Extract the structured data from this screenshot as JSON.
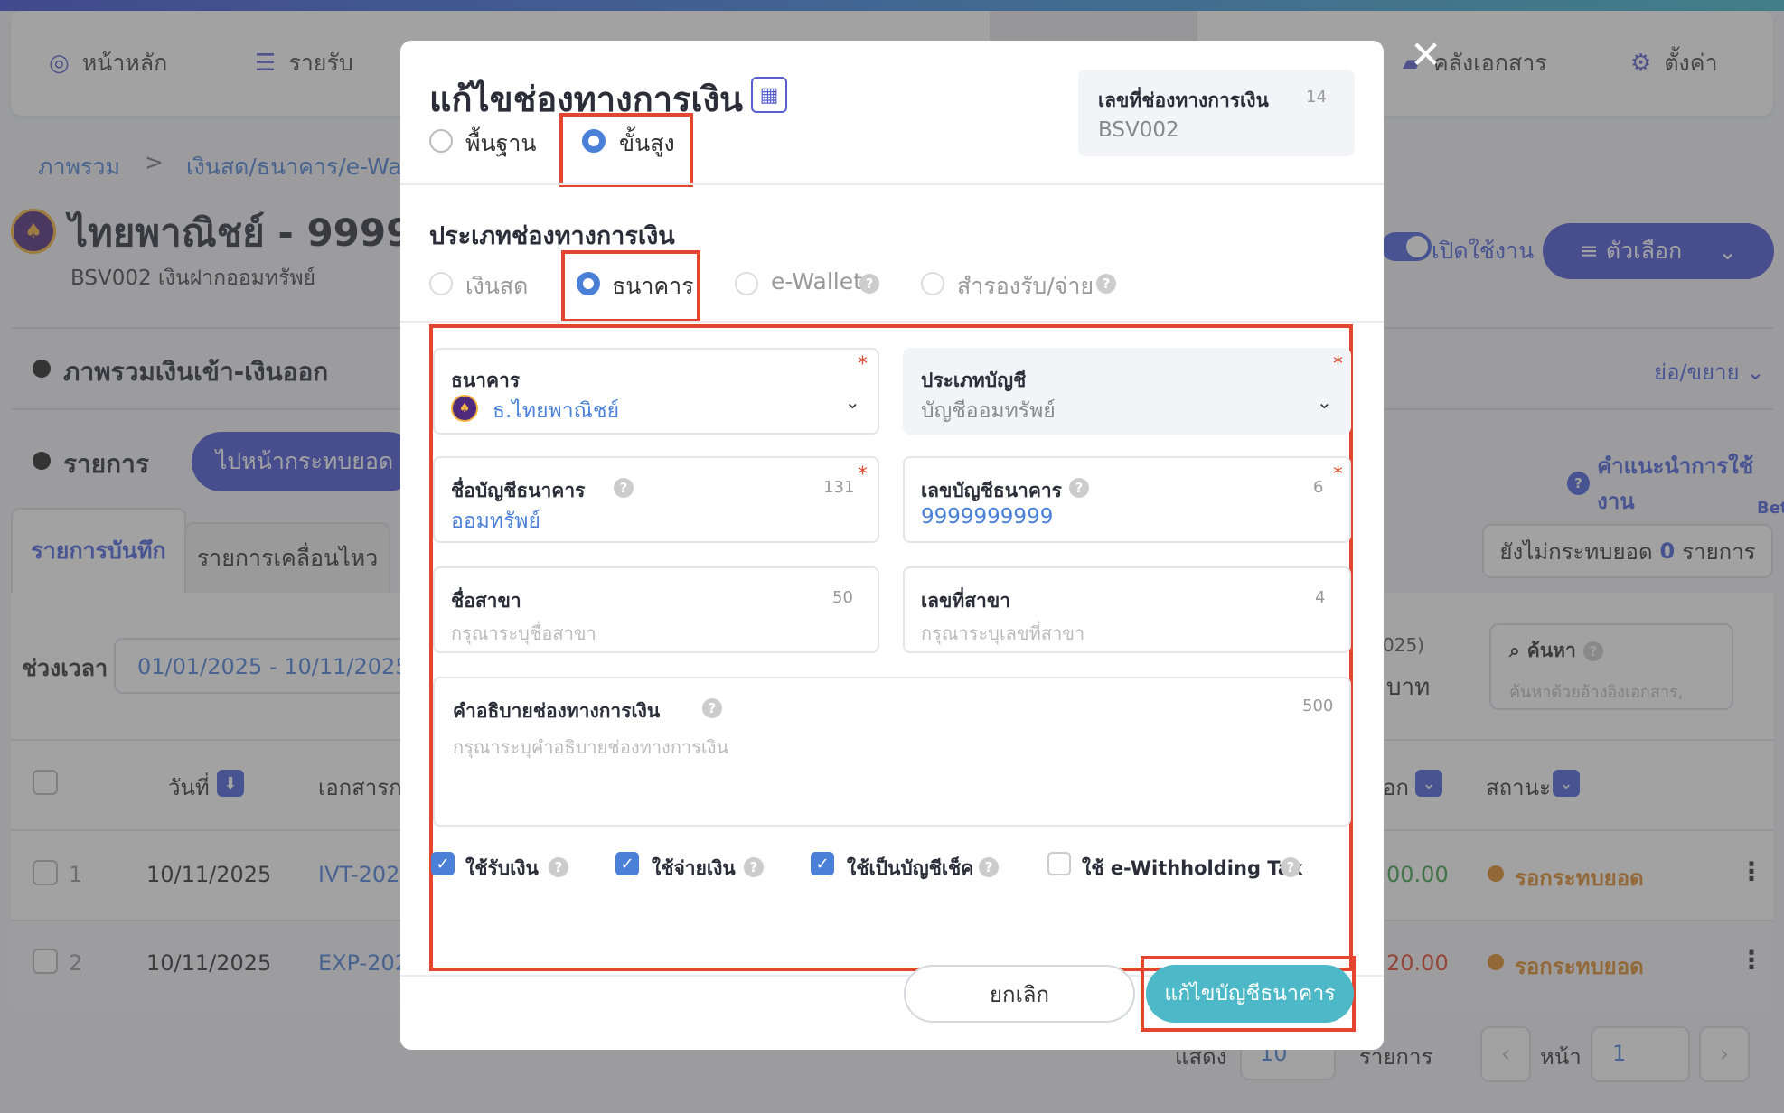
{
  "nav": {
    "items": [
      {
        "label": "หน้าหลัก",
        "icon": "chart-icon"
      },
      {
        "label": "รายรับ",
        "icon": "list-icon"
      },
      {
        "label": "คลังเอกสาร",
        "icon": "folder-icon"
      },
      {
        "label": "ตั้งค่า",
        "icon": "gear-icon"
      }
    ]
  },
  "breadcrumb": {
    "root": "ภาพรวม",
    "sep": ">",
    "current": "เงินสด/ธนาคาร/e-Walle"
  },
  "page": {
    "title": "ไทยพาณิชย์ - 999999",
    "subtitle": "BSV002 เงินฝากออมทรัพย์",
    "toggle_label": "เปิดใช้งาน",
    "options_label": "≡ ตัวเลือก",
    "section_overview": "ภาพรวมเงินเข้า-เงินออก",
    "collapse_label": "ย่อ/ขยาย",
    "section_list": "รายการ",
    "go_button": "ไปหน้ากระทบยอด",
    "help_link": "คำแนะนำการใช้งาน",
    "beta": "Bet",
    "tabs": [
      "รายการบันทึก",
      "รายการเคลื่อนไหว"
    ],
    "unreconciled_prefix": "ยังไม่กระทบยอด",
    "unreconciled_count": "0",
    "unreconciled_suffix": "รายการ",
    "period_label": "ช่วงเวลา",
    "period_value": "01/01/2025 - 10/11/2025",
    "summary_year": "025)",
    "summary_unit": "บาท",
    "search_label": "ค้นหา",
    "search_placeholder": "ค้นหาด้วยอ้างอิงเอกสาร,",
    "columns": {
      "date": "วันที่",
      "doc": "เอกสารก",
      "out": "อก",
      "status": "สถานะ"
    },
    "rows": [
      {
        "no": "1",
        "date": "10/11/2025",
        "doc": "IVT-2025",
        "amount": "00.00",
        "status": "รอกระทบยอด"
      },
      {
        "no": "2",
        "date": "10/11/2025",
        "doc": "EXP-202",
        "amount": "20.00",
        "status": "รอกระทบยอด"
      }
    ],
    "pagination": {
      "show_label": "แสดง",
      "page_size": "10",
      "rows_label": "รายการ",
      "page_label": "หน้า",
      "page": "1"
    }
  },
  "modal": {
    "title": "แก้ไขช่องทางการเงิน",
    "mode_basic": "พื้นฐาน",
    "mode_advanced": "ขั้นสูง",
    "number_label": "เลขที่ช่องทางการเงิน",
    "number_count": "14",
    "number_value": "BSV002",
    "type_heading": "ประเภทช่องทางการเงิน",
    "types": [
      "เงินสด",
      "ธนาคาร",
      "e-Wallet",
      "สำรองรับ/จ่าย"
    ],
    "bank_label": "ธนาคาร",
    "bank_value": "ธ.ไทยพาณิชย์",
    "acct_type_label": "ประเภทบัญชี",
    "acct_type_value": "บัญชีออมทรัพย์",
    "acct_name_label": "ชื่อบัญชีธนาคาร",
    "acct_name_count": "131",
    "acct_name_value": "ออมทรัพย์",
    "acct_no_label": "เลขบัญชีธนาคาร",
    "acct_no_count": "6",
    "acct_no_value": "9999999999",
    "branch_label": "ชื่อสาขา",
    "branch_count": "50",
    "branch_placeholder": "กรุณาระบุชื่อสาขา",
    "branch_no_label": "เลขที่สาขา",
    "branch_no_count": "4",
    "branch_no_placeholder": "กรุณาระบุเลขที่สาขา",
    "desc_label": "คำอธิบายช่องทางการเงิน",
    "desc_count": "500",
    "desc_placeholder": "กรุณาระบุคำอธิบายช่องทางการเงิน",
    "checks": [
      {
        "label": "ใช้รับเงิน",
        "checked": true
      },
      {
        "label": "ใช้จ่ายเงิน",
        "checked": true
      },
      {
        "label": "ใช้เป็นบัญชีเช็ค",
        "checked": true
      },
      {
        "label": "ใช้ e-Withholding Tax",
        "checked": false
      }
    ],
    "cancel_label": "ยกเลิก",
    "save_label": "แก้ไขบัญชีธนาคาร",
    "required_mark": "*",
    "check_mark": "✓"
  }
}
